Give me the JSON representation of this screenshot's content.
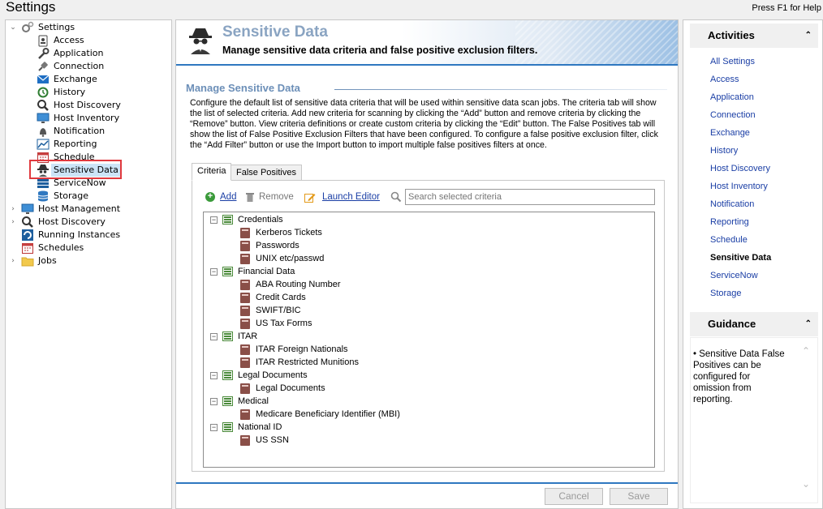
{
  "window": {
    "title": "Settings",
    "help_hint": "Press F1 for Help"
  },
  "tree": {
    "root": "Settings",
    "settings_children": [
      "Access",
      "Application",
      "Connection",
      "Exchange",
      "History",
      "Host Discovery",
      "Host Inventory",
      "Notification",
      "Reporting",
      "Schedule",
      "Sensitive Data",
      "ServiceNow",
      "Storage"
    ],
    "top_level": [
      "Host Management",
      "Host Discovery",
      "Running Instances",
      "Schedules",
      "Jobs"
    ],
    "selected": "Sensitive Data"
  },
  "header": {
    "title": "Sensitive Data",
    "subtitle": "Manage sensitive data criteria and false positive exclusion filters."
  },
  "section": {
    "title": "Manage Sensitive Data",
    "description": "Configure the default list of sensitive data criteria that will be used within sensitive data scan jobs. The criteria tab will show the list of selected criteria. Add new criteria for scanning by clicking the “Add” button and remove criteria by clicking the “Remove” button. View criteria definitions or create custom criteria by clicking the “Edit” button. The False Positives tab will show the list of False Positive Exclusion Filters that have been configured. To configure a false positive exclusion filter, click the “Add Filter” button or use the Import button to import multiple false positives filters at once."
  },
  "tabs": [
    {
      "label": "Criteria",
      "active": true
    },
    {
      "label": "False Positives",
      "active": false
    }
  ],
  "toolbar": {
    "add_label": "Add",
    "remove_label": "Remove",
    "launch_label": "Launch Editor",
    "search_placeholder": "Search selected criteria"
  },
  "criteria": [
    {
      "group": "Credentials",
      "items": [
        "Kerberos Tickets",
        "Passwords",
        "UNIX etc/passwd"
      ]
    },
    {
      "group": "Financial Data",
      "items": [
        "ABA Routing Number",
        "Credit Cards",
        "SWIFT/BIC",
        "US Tax Forms"
      ]
    },
    {
      "group": "ITAR",
      "items": [
        "ITAR Foreign Nationals",
        "ITAR Restricted Munitions"
      ]
    },
    {
      "group": "Legal Documents",
      "items": [
        "Legal Documents"
      ]
    },
    {
      "group": "Medical",
      "items": [
        "Medicare Beneficiary Identifier (MBI)"
      ]
    },
    {
      "group": "National ID",
      "items": [
        "US SSN"
      ]
    }
  ],
  "footer": {
    "cancel_label": "Cancel",
    "save_label": "Save"
  },
  "activities": {
    "title": "Activities",
    "links": [
      "All Settings",
      "Access",
      "Application",
      "Connection",
      "Exchange",
      "History",
      "Host Discovery",
      "Host Inventory",
      "Notification",
      "Reporting",
      "Schedule",
      "Sensitive Data",
      "ServiceNow",
      "Storage"
    ],
    "current": "Sensitive Data"
  },
  "guidance": {
    "title": "Guidance",
    "text": "Sensitive Data False Positives can be configured for omission from reporting."
  },
  "colors": {
    "accent_blue": "#2f78c0",
    "link": "#1a3ea5",
    "selection_outline": "#e0393e",
    "section_title": "#6c8fb8"
  }
}
